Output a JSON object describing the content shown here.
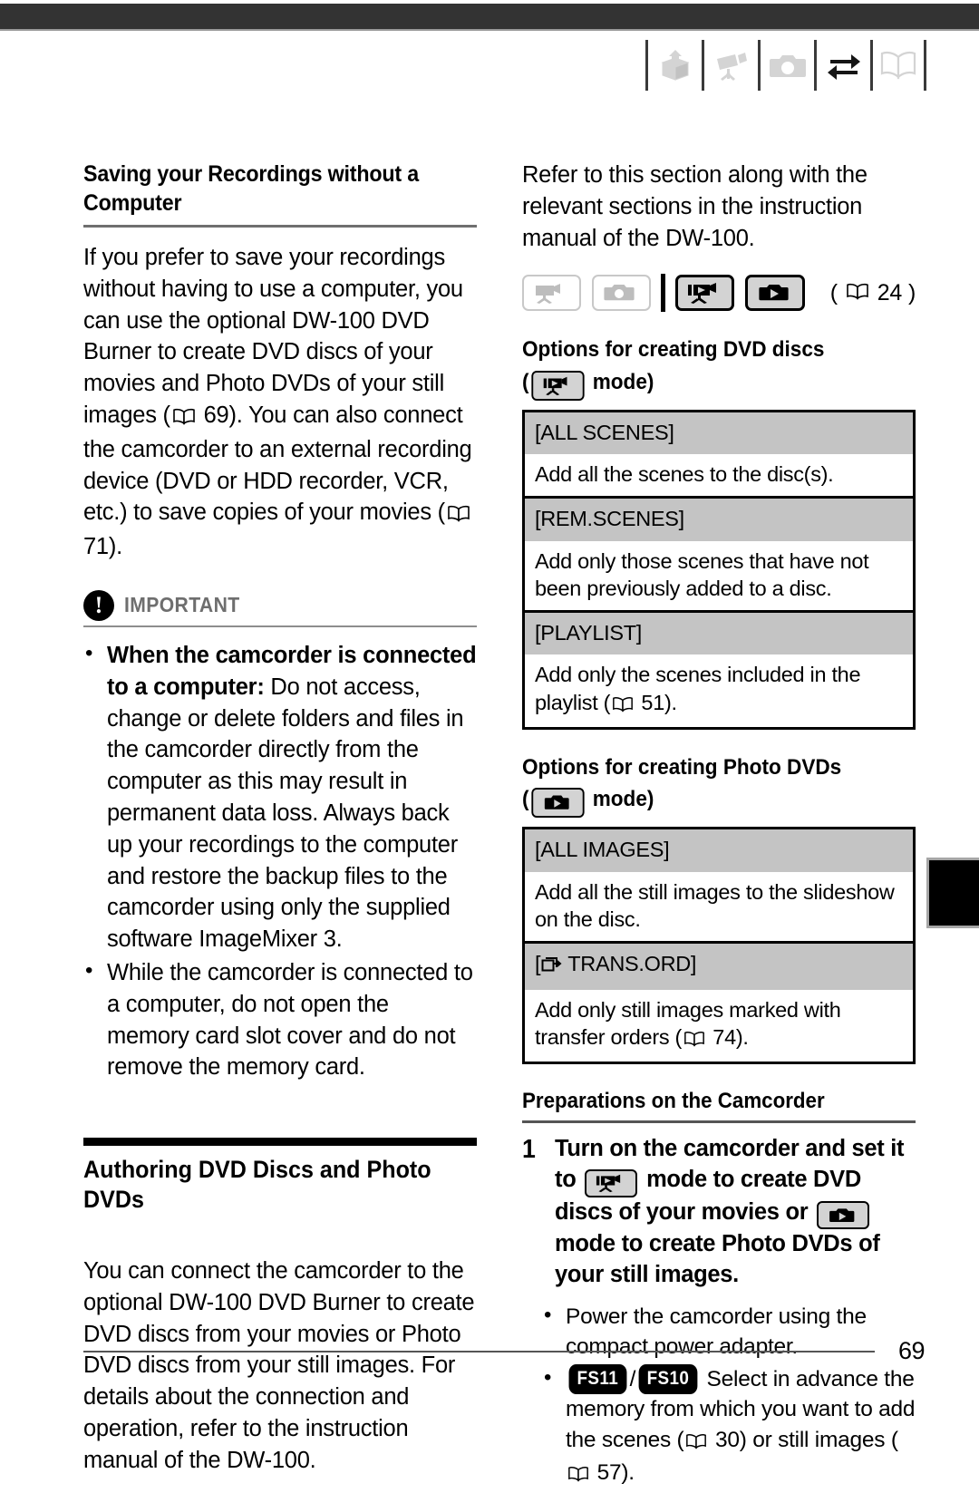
{
  "header": {
    "icons": [
      {
        "name": "box-arrow-icon",
        "label": "Introduction"
      },
      {
        "name": "camcorder-icon",
        "label": "Video"
      },
      {
        "name": "camera-icon",
        "label": "Photos"
      },
      {
        "name": "transfer-arrows-icon",
        "label": "External Connections"
      },
      {
        "name": "open-book-icon",
        "label": "Additional Information"
      }
    ]
  },
  "left_column": {
    "section_title": "Saving your Recordings without a Computer",
    "intro_paragraph_1": "If you prefer to save your recordings without having to use a computer, you can use the optional DW-100 DVD Burner to create DVD discs of your movies and Photo DVDs of your still images (",
    "intro_ref_1": "69",
    "intro_paragraph_2": "). You can also connect the camcorder to an external recording device (DVD or HDD recorder, VCR, etc.) to save copies of your movies (",
    "intro_ref_2": "71",
    "intro_paragraph_3": ").",
    "important": {
      "badge": "!",
      "label": "IMPORTANT",
      "bullets": [
        {
          "lead": "When the camcorder is connected to a computer:",
          "text": " Do not access, change or delete folders and files in the camcorder directly from the computer as this may result in permanent data loss. Always back up your recordings to the computer and restore the backup files to the camcorder using only the supplied software ImageMixer 3."
        },
        {
          "lead": "",
          "text": "While the camcorder is connected to a computer, do not open the memory card slot cover and do not remove the memory card."
        }
      ]
    },
    "authoring_title": "Authoring DVD Discs and Photo DVDs",
    "authoring_paragraph": "You can connect the camcorder to the optional DW-100 DVD Burner to create DVD discs from your movies or Photo DVD discs from your still images. For details about the connection and operation, refer to the instruction manual of the DW-100."
  },
  "right_column": {
    "refer_paragraph": "Refer to this section along with the relevant sections in the instruction manual of the DW-100.",
    "mode_row": {
      "badges": [
        {
          "name": "camcorder-record-mode",
          "state": "off"
        },
        {
          "name": "camera-record-mode",
          "state": "off"
        },
        {
          "name": "camcorder-play-mode",
          "state": "on"
        },
        {
          "name": "camera-play-mode",
          "state": "on"
        }
      ],
      "page_ref": "24"
    },
    "dvd_section": {
      "title": "Options for creating DVD discs",
      "mode_prefix": "(",
      "mode_suffix": "mode)",
      "rows": [
        {
          "option": "[ALL SCENES]",
          "description": "Add all the scenes to the disc(s)."
        },
        {
          "option": "[REM.SCENES]",
          "description": "Add only those scenes that have not been previously added to a disc."
        },
        {
          "option": "[PLAYLIST]",
          "description": "Add only the scenes included in the playlist (",
          "ref": "51",
          "description_tail": ")."
        }
      ]
    },
    "photo_section": {
      "title": "Options for creating Photo DVDs",
      "mode_prefix": "(",
      "mode_suffix": "mode)",
      "rows": [
        {
          "option": "[ALL IMAGES]",
          "description": "Add all the still images to the slideshow on the disc."
        },
        {
          "option": "TRANS.ORD]",
          "option_prefix": "[",
          "has_icon": true,
          "description": "Add only still images marked with transfer orders (",
          "ref": "74",
          "description_tail": ")."
        }
      ]
    },
    "preparations": {
      "title": "Preparations on the Camcorder",
      "step_number": "1",
      "step_text_1": "Turn on the camcorder and set it to",
      "step_text_2": "mode to create DVD discs of your movies or",
      "step_text_3": "mode to create Photo DVDs of your still images.",
      "bullets": [
        {
          "text": "Power the camcorder using the compact power adapter."
        },
        {
          "model_a": "FS11",
          "model_sep": "/",
          "model_b": "FS10",
          "text": " Select in advance the memory from which you want to add the scenes (",
          "ref_1": "30",
          "text_mid": ") or still images (",
          "ref_2": "57",
          "text_tail": ")."
        }
      ]
    }
  },
  "footer": {
    "page_number": "69"
  }
}
